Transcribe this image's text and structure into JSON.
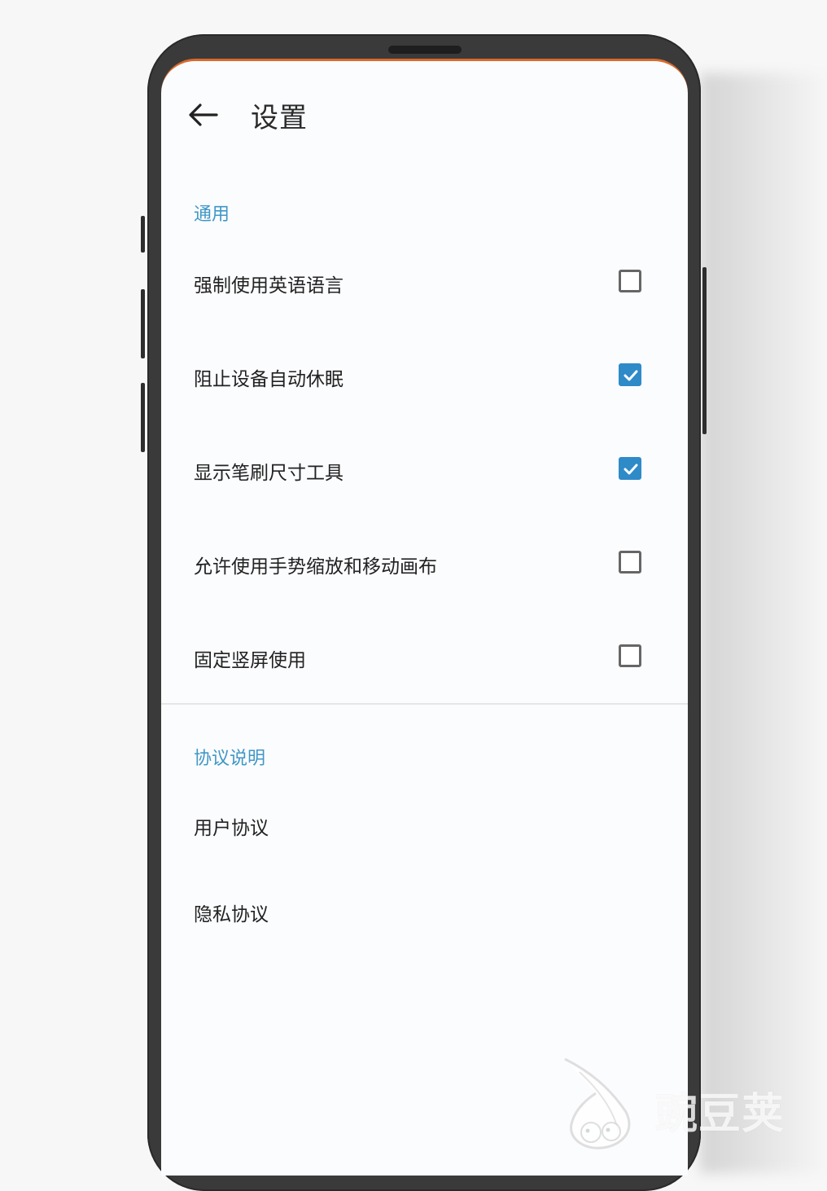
{
  "header": {
    "back_icon": "arrow-left-icon",
    "title": "设置"
  },
  "sections": [
    {
      "title": "通用",
      "items": [
        {
          "label": "强制使用英语语言",
          "checked": false
        },
        {
          "label": "阻止设备自动休眠",
          "checked": true
        },
        {
          "label": "显示笔刷尺寸工具",
          "checked": true
        },
        {
          "label": "允许使用手势缩放和移动画布",
          "checked": false
        },
        {
          "label": "固定竖屏使用",
          "checked": false
        }
      ]
    },
    {
      "title": "协议说明",
      "links": [
        {
          "label": "用户协议"
        },
        {
          "label": "隐私协议"
        }
      ]
    }
  ],
  "watermark": {
    "text": "豌豆荚",
    "icon": "bird-logo-icon"
  },
  "colors": {
    "accent": "#3f97c7",
    "checkbox_checked": "#2f8ac8",
    "status_bar": "#d86a2c"
  }
}
